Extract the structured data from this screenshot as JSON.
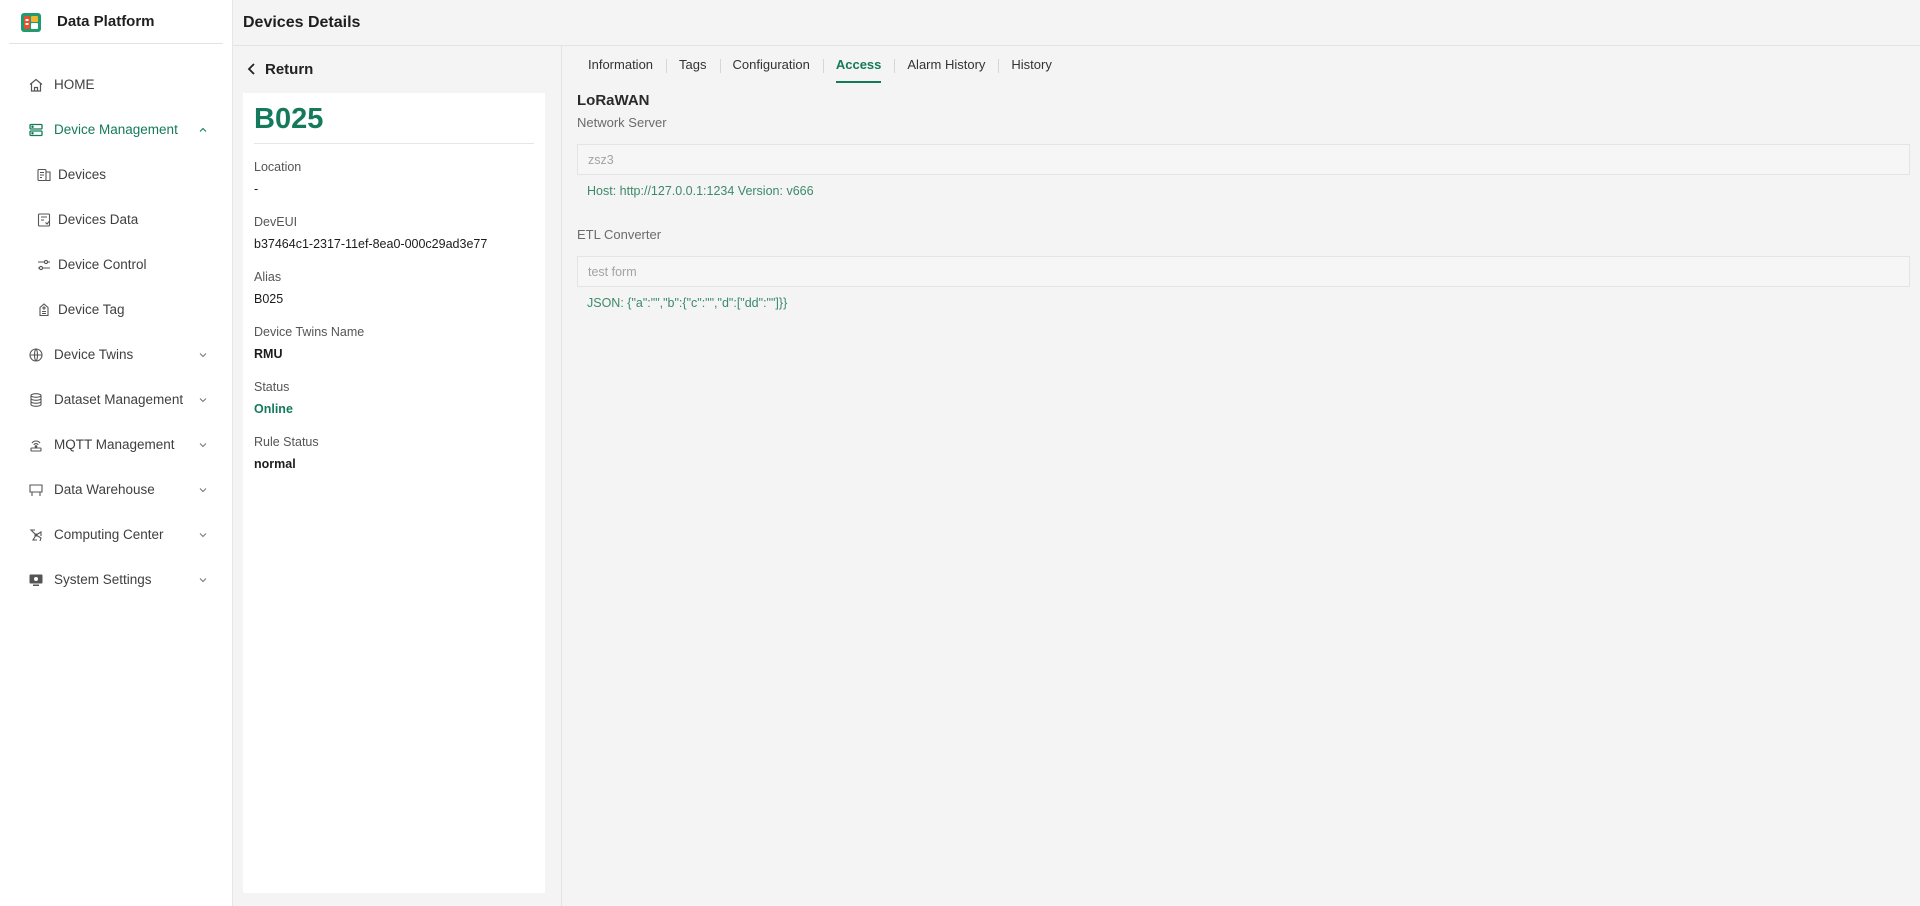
{
  "app": {
    "name": "Data Platform"
  },
  "header": {
    "title": "Devices Details"
  },
  "sidebar": {
    "items": [
      {
        "label": "HOME",
        "icon": "home-icon"
      },
      {
        "label": "Device Management",
        "icon": "server-icon",
        "expanded": true
      },
      {
        "label": "Devices",
        "icon": "devices-icon"
      },
      {
        "label": "Devices Data",
        "icon": "data-sheet-icon"
      },
      {
        "label": "Device Control",
        "icon": "sliders-icon"
      },
      {
        "label": "Device Tag",
        "icon": "tag-icon"
      },
      {
        "label": "Device Twins",
        "icon": "twins-icon"
      },
      {
        "label": "Dataset Management",
        "icon": "database-icon"
      },
      {
        "label": "MQTT Management",
        "icon": "broadcast-icon"
      },
      {
        "label": "Data Warehouse",
        "icon": "warehouse-icon"
      },
      {
        "label": "Computing Center",
        "icon": "compute-icon"
      },
      {
        "label": "System Settings",
        "icon": "monitor-icon"
      }
    ]
  },
  "detail": {
    "return_label": "Return",
    "device_name": "B025",
    "fields": [
      {
        "label": "Location",
        "value": "-"
      },
      {
        "label": "DevEUI",
        "value": "b37464c1-2317-11ef-8ea0-000c29ad3e77"
      },
      {
        "label": "Alias",
        "value": "B025"
      },
      {
        "label": "Device Twins Name",
        "value": "RMU"
      },
      {
        "label": "Status",
        "value": "Online"
      },
      {
        "label": "Rule Status",
        "value": "normal"
      }
    ]
  },
  "tabs": [
    {
      "label": "Information"
    },
    {
      "label": "Tags"
    },
    {
      "label": "Configuration"
    },
    {
      "label": "Access",
      "active": true
    },
    {
      "label": "Alarm History"
    },
    {
      "label": "History"
    }
  ],
  "access": {
    "section_title": "LoRaWAN",
    "network_server": {
      "label": "Network Server",
      "placeholder": "zsz3",
      "hint": "Host: http://127.0.0.1:1234 Version: v666"
    },
    "etl": {
      "label": "ETL Converter",
      "placeholder": "test form",
      "hint": "JSON: {\"a\":\"\",\"b\":{\"c\":\"\",\"d\":[\"dd\":\"\"]}}"
    }
  },
  "colors": {
    "accent": "#147a5b",
    "hint": "#3c8a6a",
    "background": "#f4f4f4"
  }
}
